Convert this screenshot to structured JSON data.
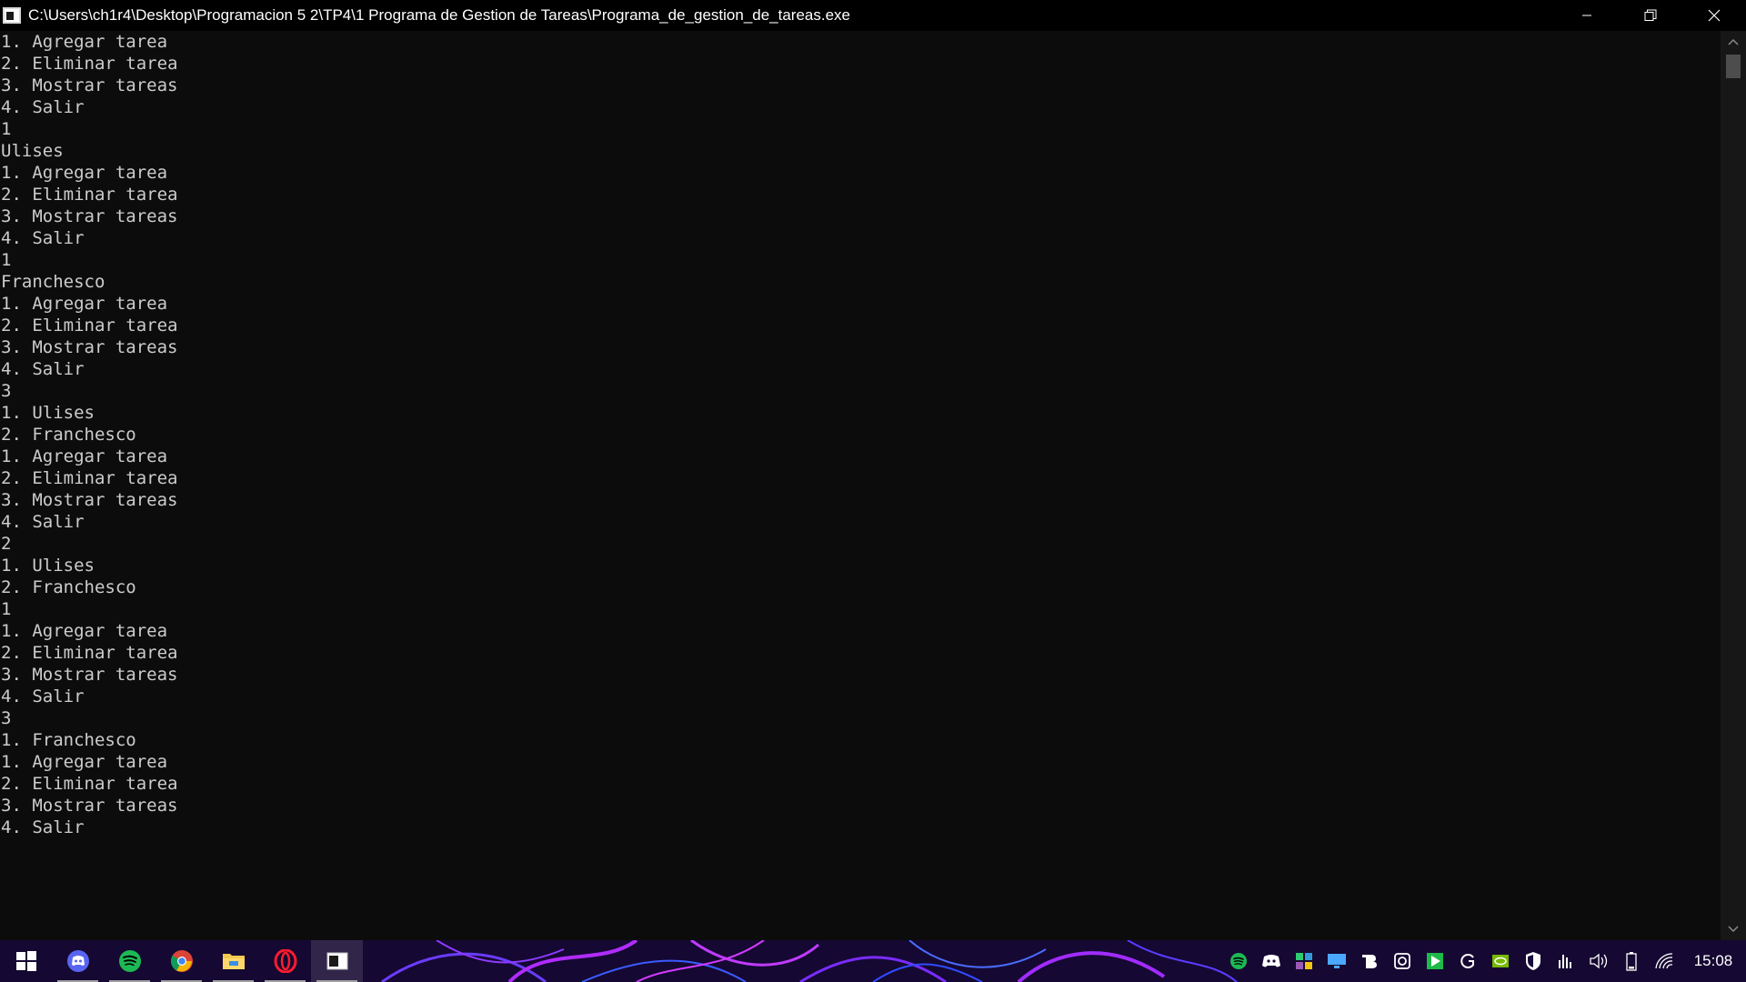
{
  "window": {
    "title": "C:\\Users\\ch1r4\\Desktop\\Programacion 5 2\\TP4\\1 Programa de Gestion de Tareas\\Programa_de_gestion_de_tareas.exe",
    "controls": [
      "minimize",
      "restore",
      "close"
    ]
  },
  "console": {
    "lines": [
      "1. Agregar tarea",
      "2. Eliminar tarea",
      "3. Mostrar tareas",
      "4. Salir",
      "1",
      "Ulises",
      "1. Agregar tarea",
      "2. Eliminar tarea",
      "3. Mostrar tareas",
      "4. Salir",
      "1",
      "Franchesco",
      "1. Agregar tarea",
      "2. Eliminar tarea",
      "3. Mostrar tareas",
      "4. Salir",
      "3",
      "1. Ulises",
      "2. Franchesco",
      "1. Agregar tarea",
      "2. Eliminar tarea",
      "3. Mostrar tareas",
      "4. Salir",
      "2",
      "1. Ulises",
      "2. Franchesco",
      "1",
      "1. Agregar tarea",
      "2. Eliminar tarea",
      "3. Mostrar tareas",
      "4. Salir",
      "3",
      "1. Franchesco",
      "1. Agregar tarea",
      "2. Eliminar tarea",
      "3. Mostrar tareas",
      "4. Salir"
    ]
  },
  "taskbar": {
    "apps": [
      "start-icon",
      "discord-icon",
      "spotify-icon",
      "chrome-icon",
      "file-explorer-icon",
      "opera-icon",
      "terminal-icon"
    ],
    "tray_icons": [
      "spotify-icon",
      "discord-icon",
      "app-grid-icon",
      "monitor-icon",
      "b-icon",
      "camera-icon",
      "play-icon",
      "g-icon",
      "nvidia-icon",
      "shield-icon",
      "equalizer-icon",
      "volume-icon",
      "battery-icon",
      "wifi-icon"
    ],
    "clock": "15:08"
  },
  "colors": {
    "console_bg": "#0c0c0c",
    "console_text": "#cccccc",
    "titlebar_bg": "#000000"
  }
}
